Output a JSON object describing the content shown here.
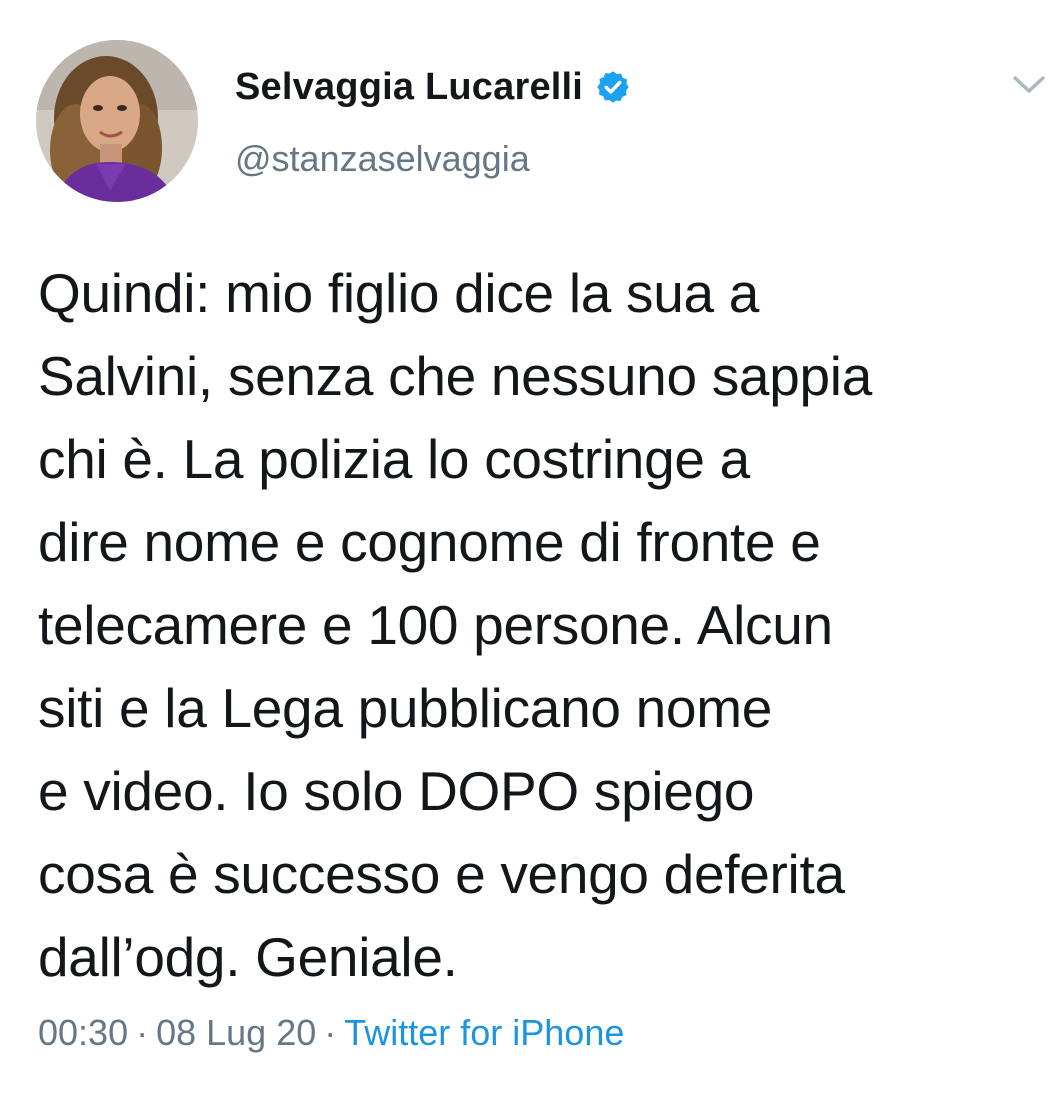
{
  "user": {
    "display_name": "Selvaggia Lucarelli",
    "handle": "@stanzaselvaggia",
    "verified": true,
    "avatar_icon": "profile-photo"
  },
  "tweet": {
    "text": "Quindi: mio figlio dice la sua a\nSalvini, senza che nessuno sappia\nchi è. La polizia lo costringe a\ndire nome e cognome di fronte e\ntelecamere e 100 persone. Alcun\nsiti e la Lega pubblicano nome\ne video. Io solo DOPO spiego\ncosa è successo e vengo deferita\ndall’odg. Geniale."
  },
  "meta": {
    "time": "00:30",
    "date": "08 Lug 20",
    "separator": "·",
    "source": "Twitter for iPhone"
  },
  "colors": {
    "text": "#14171a",
    "secondary": "#657786",
    "link": "#1b95e0",
    "verified": "#1da1f2"
  },
  "icons": {
    "verified": "verified-badge-icon",
    "menu": "chevron-down-icon"
  }
}
